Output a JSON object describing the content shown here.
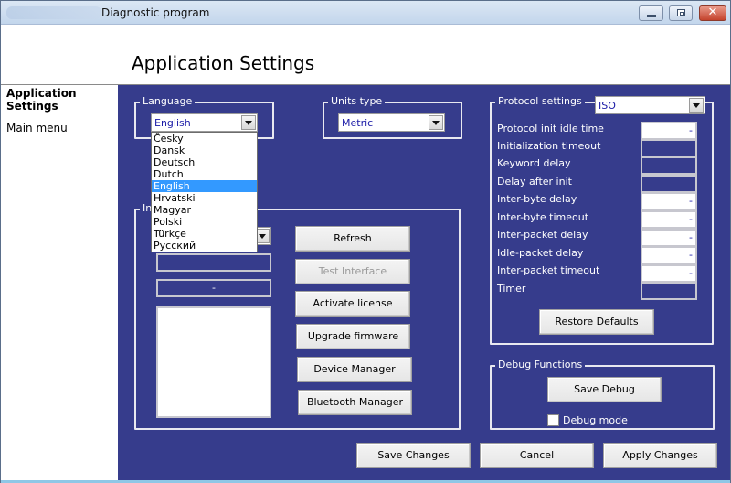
{
  "window": {
    "title": "Diagnostic program",
    "controls": {
      "minimize": "minimize",
      "maximize": "maximize",
      "close": "✕"
    }
  },
  "header": {
    "title": "Application Settings"
  },
  "sidebar": {
    "items": [
      {
        "label": "Application Settings",
        "active": true
      },
      {
        "label": "Main menu",
        "active": false
      }
    ]
  },
  "language": {
    "group_label": "Language",
    "selected": "English",
    "options": [
      "Česky",
      "Dansk",
      "Deutsch",
      "Dutch",
      "English",
      "Hrvatski",
      "Magyar",
      "Polski",
      "Türkçe",
      "Русский"
    ],
    "highlighted_index": 4
  },
  "units": {
    "group_label": "Units type",
    "selected": "Metric"
  },
  "interface": {
    "group_label": "In",
    "field_1_value": "",
    "field_2_value": "-",
    "buttons": {
      "refresh": "Refresh",
      "test_interface": "Test Interface",
      "activate_license": "Activate license",
      "upgrade_firmware": "Upgrade firmware",
      "device_manager": "Device Manager",
      "bluetooth_manager": "Bluetooth Manager"
    }
  },
  "protocol": {
    "group_label": "Protocol settings",
    "selected": "ISO",
    "rows": [
      {
        "label": "Protocol init idle time",
        "value": "-",
        "enabled": true
      },
      {
        "label": "Initialization timeout",
        "value": "",
        "enabled": false
      },
      {
        "label": "Keyword delay",
        "value": "",
        "enabled": false
      },
      {
        "label": "Delay after init",
        "value": "",
        "enabled": false
      },
      {
        "label": "Inter-byte delay",
        "value": "-",
        "enabled": true
      },
      {
        "label": "Inter-byte timeout",
        "value": "-",
        "enabled": true
      },
      {
        "label": "Inter-packet delay",
        "value": "-",
        "enabled": true
      },
      {
        "label": "Idle-packet delay",
        "value": "-",
        "enabled": true
      },
      {
        "label": "Inter-packet timeout",
        "value": "-",
        "enabled": true
      },
      {
        "label": "Timer",
        "value": "",
        "enabled": false
      }
    ],
    "restore_defaults": "Restore Defaults"
  },
  "debug": {
    "group_label": "Debug Functions",
    "save_debug": "Save Debug",
    "debug_mode_label": "Debug mode",
    "debug_mode_checked": false
  },
  "footer": {
    "save_changes": "Save Changes",
    "cancel": "Cancel",
    "apply_changes": "Apply Changes"
  },
  "colors": {
    "panel_background": "#363c8c",
    "selection_highlight": "#3399ff",
    "combo_text": "#1a1aa6"
  }
}
